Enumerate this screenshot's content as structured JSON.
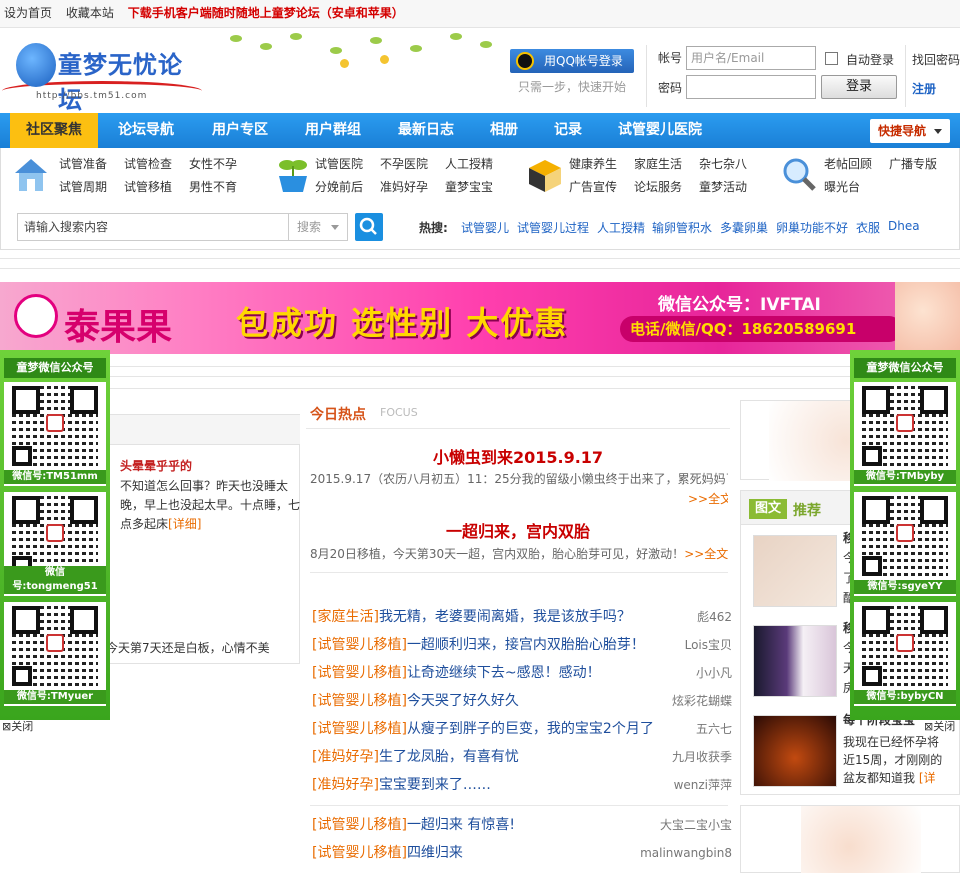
{
  "topbar": {
    "set_home": "设为首页",
    "bookmark": "收藏本站",
    "promo": "下载手机客户端随时随地上童梦论坛（安卓和苹果）"
  },
  "logo": {
    "name": "童梦无忧论坛",
    "url": "http://bbs.tm51.com"
  },
  "login": {
    "qq_button": "用QQ帐号登录",
    "qq_sub": "只需一步，快速开始",
    "account_label": "帐号",
    "account_placeholder": "用户名/Email",
    "password_label": "密码",
    "remember_label": "自动登录",
    "login_button": "登录",
    "forgot": "找回密码",
    "register": "注册"
  },
  "nav": {
    "items": [
      "社区聚焦",
      "论坛导航",
      "用户专区",
      "用户群组",
      "最新日志",
      "相册",
      "记录",
      "试管婴儿医院"
    ],
    "quick": "快捷导航"
  },
  "categories": [
    [
      "试管准备",
      "试管检查",
      "女性不孕",
      "试管周期",
      "试管移植",
      "男性不育"
    ],
    [
      "试管医院",
      "不孕医院",
      "人工授精",
      "分娩前后",
      "准妈好孕",
      "童梦宝宝"
    ],
    [
      "健康养生",
      "家庭生活",
      "杂七杂八",
      "广告宣传",
      "论坛服务",
      "童梦活动"
    ],
    [
      "老帖回顾",
      "广播专版",
      "曝光台"
    ]
  ],
  "search": {
    "placeholder": "请输入搜索内容",
    "select_label": "搜索",
    "hot_label": "热搜:",
    "hot_terms": [
      "试管婴儿",
      "试管婴儿过程",
      "人工授精",
      "输卵管积水",
      "多囊卵巢",
      "卵巢功能不好",
      "衣服",
      "Dhea"
    ]
  },
  "banner": {
    "brand": "泰果果",
    "slogan": "包成功 选性别 大优惠",
    "wechat": "微信公众号：IVFTAI",
    "phone": "电话/微信/QQ：18620589691"
  },
  "qr_left": {
    "header": "童梦微信公众号",
    "ids": [
      "微信号:TM51mm",
      "微信号:tongmeng51",
      "微信号:TMyuer"
    ],
    "close": "关闭"
  },
  "qr_right": {
    "header": "童梦微信公众号",
    "ids": [
      "微信号:TMbyby",
      "微信号:sgyeYY",
      "微信号:bybyCN"
    ],
    "close": "关闭"
  },
  "left_panel": {
    "author": "头晕晕乎乎的",
    "text": "不知道怎么回事？昨天也没睡太晚，早上也没起太早。十点睡，七点多起床",
    "detail": "[详细]",
    "bottom": "今天第7天还是白板，心情不美"
  },
  "hot": {
    "title": "今日热点",
    "focus": "FOCUS",
    "headlines": [
      {
        "title": "小懒虫到来2015.9.17",
        "summary": "2015.9.17（农历八月初五）11：25分我的留级小懒虫终于出来了，累死妈妈了，顺产，16号晚快凌晨见红后有阵痛，家人立即开车送我上医院，从",
        "more": ">>全文"
      },
      {
        "title": "一超归来，宫内双胎",
        "summary": "8月20日移植，今天第30天一超，宫内双胎，胎心胎芽可见，好激动！",
        "more": ">>全文"
      }
    ],
    "threads": [
      {
        "cat": "[家庭生活]",
        "title": "我无精，老婆要闹离婚，我是该放手吗？",
        "author": "彪462"
      },
      {
        "cat": "[试管婴儿移植]",
        "title": "一超顺利归来，接宫内双胎胎心胎芽！",
        "author": "Lois宝贝"
      },
      {
        "cat": "[试管婴儿移植]",
        "title": "让奇迹继续下去~感恩！感动！",
        "author": "小小凡"
      },
      {
        "cat": "[试管婴儿移植]",
        "title": "今天哭了好久好久",
        "author": "炫彩花蝴蝶"
      },
      {
        "cat": "[试管婴儿移植]",
        "title": "从瘦子到胖子的巨变，我的宝宝2个月了",
        "author": "五六七"
      },
      {
        "cat": "[准妈好孕]",
        "title": "生了龙凤胎，有喜有忧",
        "author": "九月收获季"
      },
      {
        "cat": "[准妈好孕]",
        "title": "宝宝要到来了……",
        "author": "wenzi萍萍"
      }
    ],
    "threads2": [
      {
        "cat": "[试管婴儿移植]",
        "title": "一超归来 有惊喜!",
        "author": "大宝二宝小宝"
      },
      {
        "cat": "[试管婴儿移植]",
        "title": "四维归来",
        "author": "malinwangbin8"
      }
    ]
  },
  "right_panel": {
    "tag": "图文",
    "tag2": "推荐",
    "items": [
      {
        "head": "移",
        "lines": [
          "今",
          "了",
          "酷"
        ]
      },
      {
        "head": "移",
        "lines": [
          "今",
          "天",
          "房"
        ]
      },
      {
        "head": "每个阶段宝宝",
        "lines": [
          "我现在已经怀孕将",
          "近15周，才刚刚的",
          "盆友都知道我"
        ],
        "more": "[详"
      }
    ]
  }
}
